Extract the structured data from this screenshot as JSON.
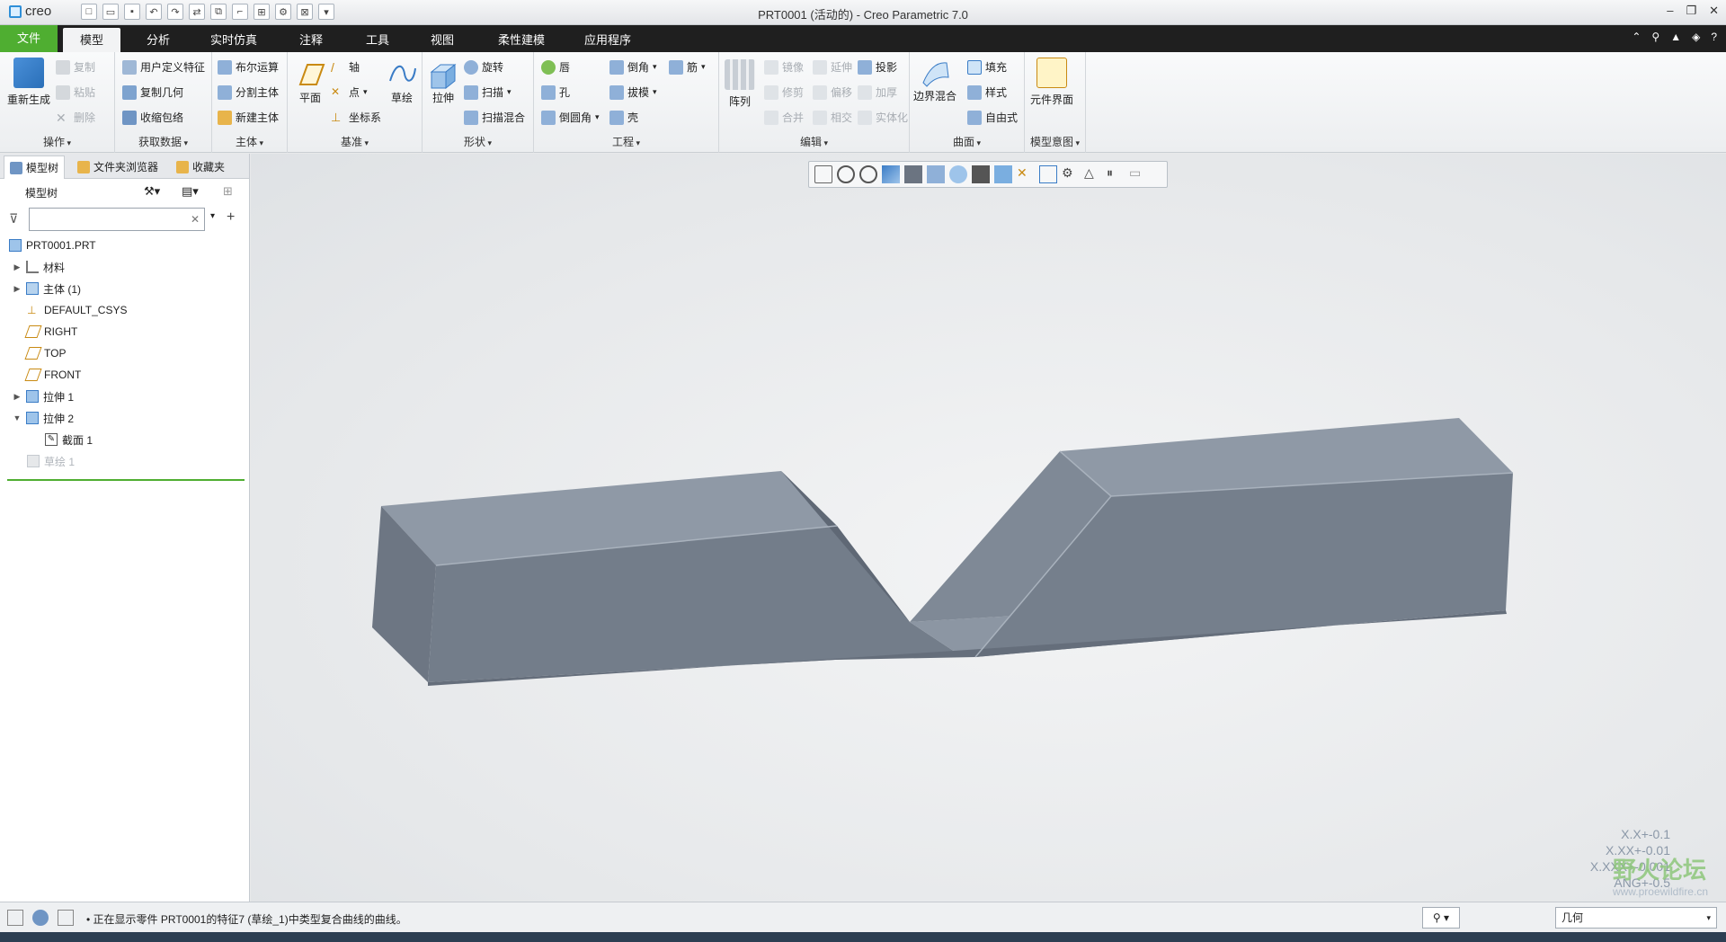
{
  "titlebar": {
    "logo": "creo",
    "title": "PRT0001 (活动的) - Creo Parametric 7.0",
    "controls": [
      "–",
      "❐",
      "✕"
    ]
  },
  "tabs": [
    "文件",
    "模型",
    "分析",
    "实时仿真",
    "注释",
    "工具",
    "视图",
    "柔性建模",
    "应用程序"
  ],
  "ribbon": {
    "ops": {
      "regen": "重新生成",
      "copy": "复制",
      "paste": "粘贴",
      "delete": "删除",
      "label": "操作"
    },
    "getdata": {
      "udf": "用户定义特征",
      "copygeom": "复制几何",
      "shrink": "收缩包络",
      "label": "获取数据"
    },
    "body": {
      "boolean": "布尔运算",
      "split": "分割主体",
      "newbody": "新建主体",
      "label": "主体"
    },
    "datum": {
      "plane": "平面",
      "axis": "轴",
      "point": "点",
      "csys": "坐标系",
      "sketch": "草绘",
      "label": "基准"
    },
    "shapes": {
      "extrude": "拉伸",
      "revolve": "旋转",
      "sweep": "扫描",
      "sweptblend": "扫描混合",
      "label": "形状"
    },
    "eng": {
      "hole": "孔",
      "round": "倒圆角",
      "chamfer": "倒角",
      "draft": "拔模",
      "shell": "壳",
      "rib": "筋",
      "lip": "唇",
      "label": "工程"
    },
    "edit": {
      "pattern": "阵列",
      "mirror": "镜像",
      "trim": "修剪",
      "merge": "合并",
      "extend": "延伸",
      "offset": "偏移",
      "intersect": "相交",
      "project": "投影",
      "thicken": "加厚",
      "solidify": "实体化",
      "label": "编辑"
    },
    "surfaces": {
      "boundary": "边界混合",
      "fill": "填充",
      "style": "样式",
      "freestyle": "自由式",
      "label": "曲面"
    },
    "intent": {
      "compint": "元件界面",
      "label": "模型意图"
    }
  },
  "panel": {
    "tabs": [
      "模型树",
      "文件夹浏览器",
      "收藏夹"
    ],
    "tree_title": "模型树",
    "search_placeholder": "",
    "nodes": [
      "PRT0001.PRT",
      "材料",
      "主体 (1)",
      "DEFAULT_CSYS",
      "RIGHT",
      "TOP",
      "FRONT",
      "拉伸 1",
      "拉伸 2",
      "截面 1",
      "草绘 1"
    ]
  },
  "viewport": {
    "tolerance": [
      "X.X+-0.1",
      "X.XX+-0.01",
      "X.XXX+-0.001",
      "ANG+-0.5"
    ],
    "watermark": "野火论坛",
    "watermark_url": "www.proewildfire.cn"
  },
  "statusbar": {
    "message": "• 正在显示零件 PRT0001的特征7 (草绘_1)中类型复合曲线的曲线。",
    "filter": "几何"
  },
  "colors": {
    "file_tab": "#4fae31",
    "model_face_top": "#8e98a5",
    "model_face_front": "#757f8c",
    "model_face_side": "#6b7481"
  }
}
